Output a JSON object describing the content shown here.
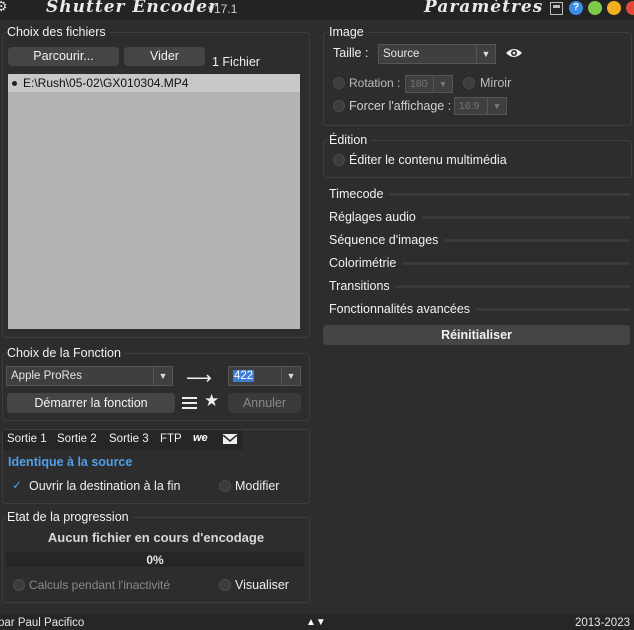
{
  "app": {
    "title": "Shutter Encoder",
    "version": "v17.1",
    "settings_title": "Paramètres"
  },
  "files": {
    "heading": "Choix des fichiers",
    "browse_label": "Parcourir...",
    "clear_label": "Vider",
    "count_label": "1 Fichier",
    "items": [
      "E:\\Rush\\05-02\\GX010304.MP4"
    ]
  },
  "function": {
    "heading": "Choix de la Fonction",
    "selected": "Apple ProRes",
    "codec": "422",
    "start_label": "Démarrer la fonction",
    "cancel_label": "Annuler"
  },
  "output": {
    "tabs": [
      "Sortie 1",
      "Sortie 2",
      "Sortie 3",
      "FTP"
    ],
    "same_as_source": "Identique à la source",
    "open_destination": "Ouvrir la destination à la fin",
    "modify_label": "Modifier"
  },
  "progress": {
    "heading": "Etat de la progression",
    "status": "Aucun fichier en cours d'encodage",
    "percent_label": "0%",
    "percent": 0,
    "idle_calc": "Calculs pendant l'inactivité",
    "preview_label": "Visualiser"
  },
  "image": {
    "heading": "Image",
    "size_label": "Taille :",
    "size_value": "Source",
    "rotation_label": "Rotation :",
    "rotation_value": "180",
    "mirror_label": "Miroir",
    "force_display_label": "Forcer l'affichage :",
    "force_display_value": "16:9"
  },
  "edition": {
    "heading": "Édition",
    "edit_media_label": "Éditer le contenu multimédia"
  },
  "sections": [
    "Timecode",
    "Réglages audio",
    "Séquence d'images",
    "Colorimétrie",
    "Transitions",
    "Fonctionnalités avancées"
  ],
  "reset_label": "Réinitialiser",
  "footer": {
    "author": "par Paul Pacifico",
    "years": "2013-2023"
  },
  "colors": {
    "background": "#2d2d2d",
    "accent_blue": "#4f9fe8",
    "file_list_bg": "#b4b4b4"
  }
}
